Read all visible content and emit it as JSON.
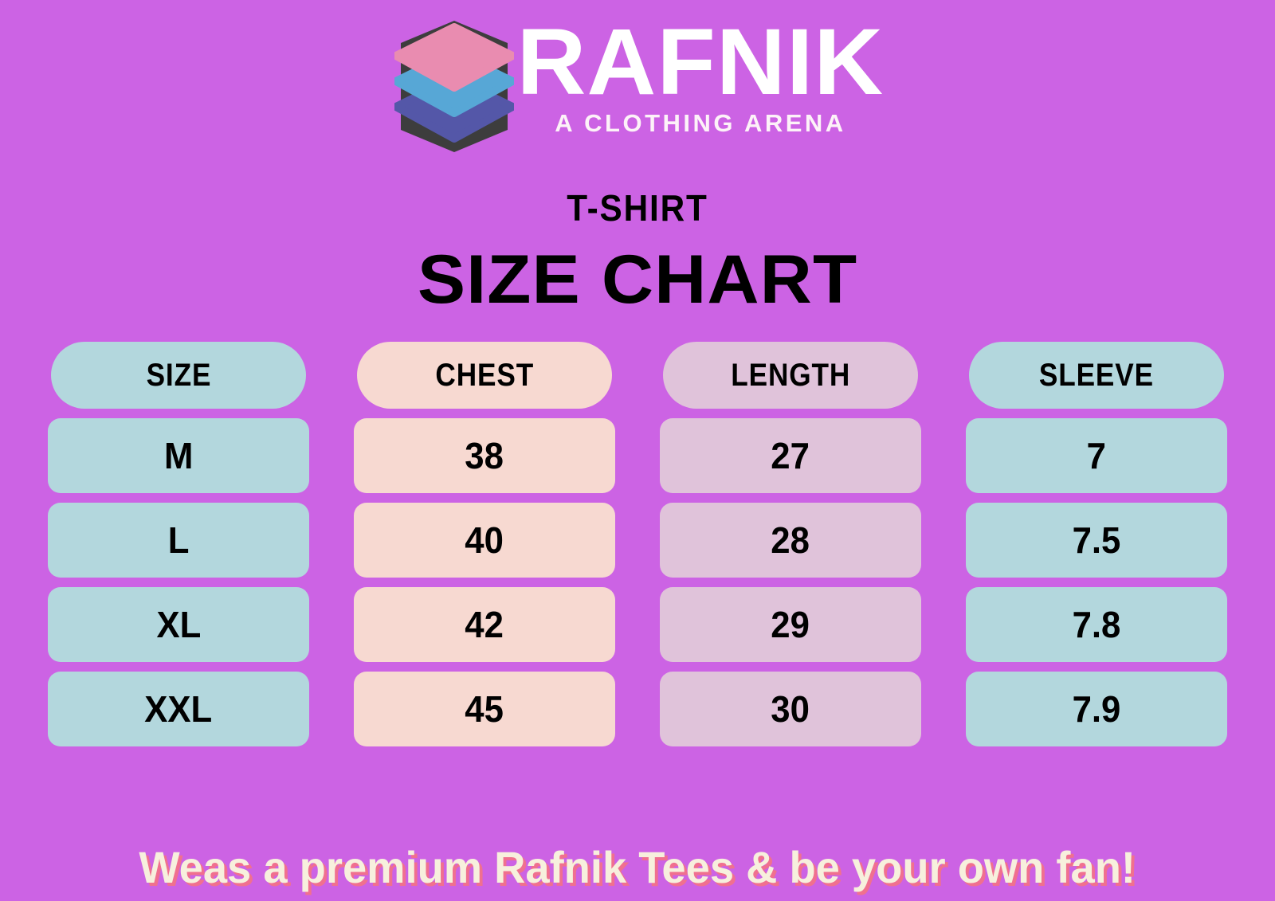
{
  "theme": {
    "background": "#cc63e4",
    "blue": "#b3d7dd",
    "peach": "#f7d9d1",
    "mauve": "#e0c3da",
    "footer_text_color": "#f7f0dd",
    "footer_shadow_color": "#f0708f",
    "brand_text_color": "#ffffff",
    "logo_pink": "#e98cb0",
    "logo_blue": "#57a7d6",
    "logo_purple": "#5457a8",
    "logo_dark": "#3d3d3d"
  },
  "logo": {
    "mark": "stacked-layers-icon",
    "brand_name": "RAFNIK",
    "tagline": "A CLOTHING ARENA"
  },
  "headings": {
    "subtitle": "T-SHIRT",
    "title": "SIZE CHART"
  },
  "chart_data": {
    "type": "table",
    "title": "SIZE CHART",
    "subtitle": "T-SHIRT",
    "columns": [
      "SIZE",
      "CHEST",
      "LENGTH",
      "SLEEVE"
    ],
    "column_colors": [
      "#b3d7dd",
      "#f7d9d1",
      "#e0c3da",
      "#b3d7dd"
    ],
    "rows": [
      {
        "size": "M",
        "chest": "38",
        "length": "27",
        "sleeve": "7"
      },
      {
        "size": "L",
        "chest": "40",
        "length": "28",
        "sleeve": "7.5"
      },
      {
        "size": "XL",
        "chest": "42",
        "length": "29",
        "sleeve": "7.8"
      },
      {
        "size": "XXL",
        "chest": "45",
        "length": "30",
        "sleeve": "7.9"
      }
    ]
  },
  "footer": {
    "message": "Weas a premium Rafnik Tees & be your own fan!"
  }
}
